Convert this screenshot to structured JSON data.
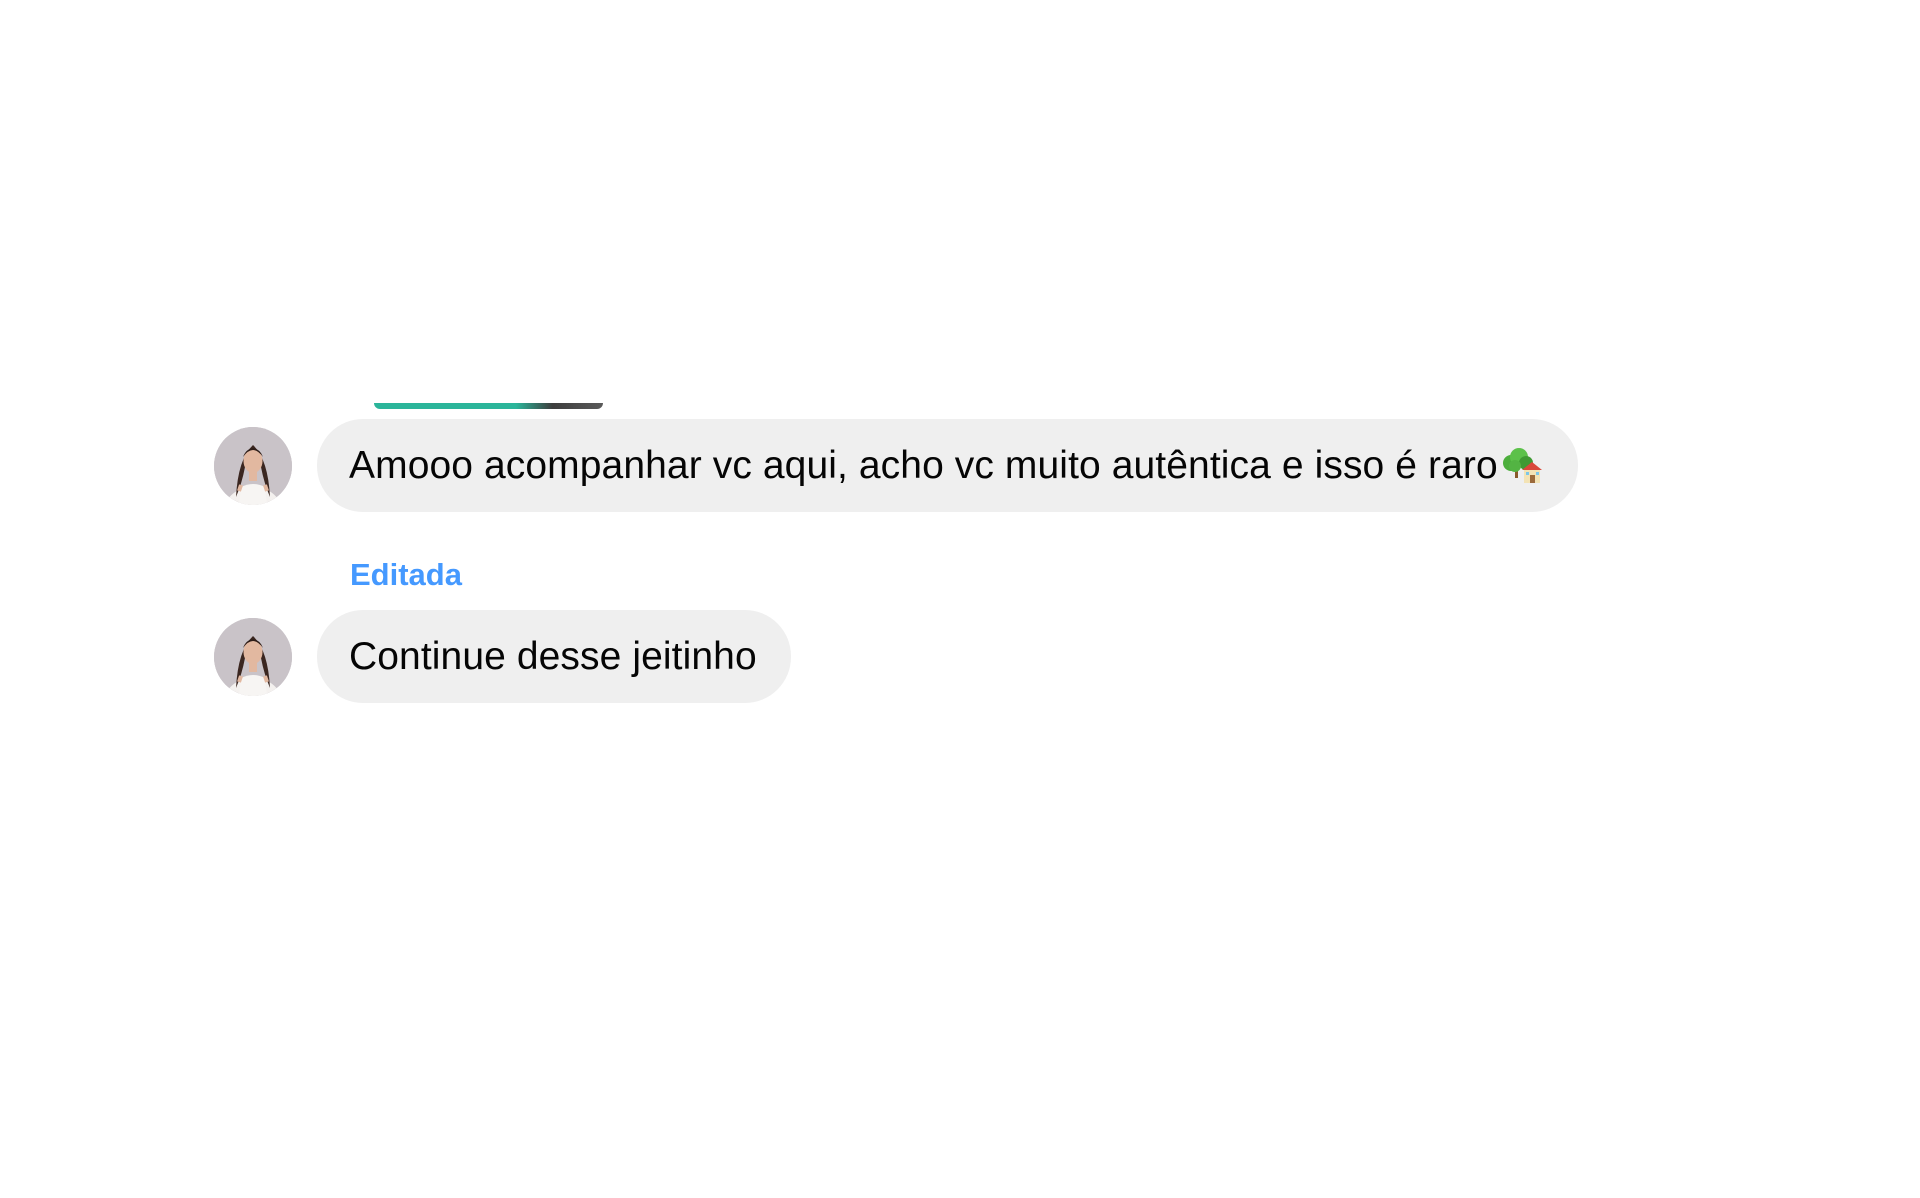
{
  "thread": {
    "messages": [
      {
        "text": "Amooo acompanhar vc aqui, acho vc muito autêntica e isso é raro",
        "emoji": "house-with-tree-emoji",
        "edited": false
      },
      {
        "edited_label": "Editada",
        "text": "Continue desse jeitinho",
        "edited": true
      }
    ]
  },
  "colors": {
    "bubble_background": "#efefef",
    "text": "#050505",
    "edited_label": "#4599ff",
    "page_background": "#ffffff"
  }
}
